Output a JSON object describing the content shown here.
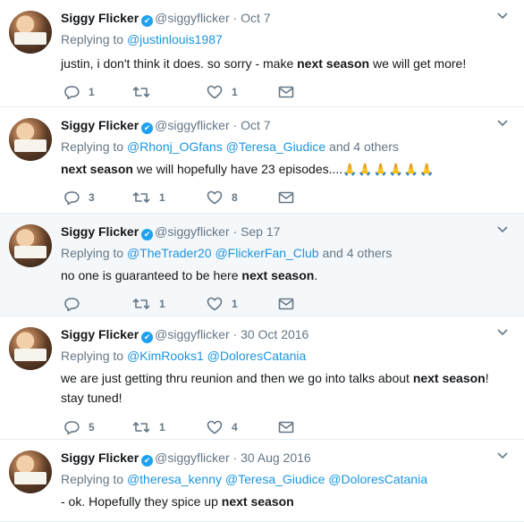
{
  "tweets": [
    {
      "name": "Siggy Flicker",
      "handle": "@siggyflicker",
      "date": "Oct 7",
      "replying_label": "Replying to",
      "replying": [
        "@justinlouis1987"
      ],
      "replying_more": "",
      "text_before": "justin, i don't think it does. so sorry - make ",
      "text_bold": "next season",
      "text_after": " we will get more!",
      "emoji": "",
      "replies": "1",
      "retweets": "",
      "likes": "1"
    },
    {
      "name": "Siggy Flicker",
      "handle": "@siggyflicker",
      "date": "Oct 7",
      "replying_label": "Replying to",
      "replying": [
        "@Rhonj_OGfans",
        "@Teresa_Giudice"
      ],
      "replying_more": "and 4 others",
      "text_before": "",
      "text_bold": "next season",
      "text_after": " we will hopefully have 23 episodes....",
      "emoji": "🙏🙏🙏🙏🙏🙏",
      "replies": "3",
      "retweets": "1",
      "likes": "8"
    },
    {
      "name": "Siggy Flicker",
      "handle": "@siggyflicker",
      "date": "Sep 17",
      "replying_label": "Replying to",
      "replying": [
        "@TheTrader20",
        "@FlickerFan_Club"
      ],
      "replying_more": "and 4 others",
      "text_before": "no one is guaranteed to be here ",
      "text_bold": "next season",
      "text_after": ".",
      "emoji": "",
      "replies": "",
      "retweets": "1",
      "likes": "1"
    },
    {
      "name": "Siggy Flicker",
      "handle": "@siggyflicker",
      "date": "30 Oct 2016",
      "replying_label": "Replying to",
      "replying": [
        "@KimRooks1",
        "@DoloresCatania"
      ],
      "replying_more": "",
      "text_before": "we are just getting thru reunion and then we go into talks about ",
      "text_bold": "next season",
      "text_after": "! stay tuned!",
      "emoji": "",
      "replies": "5",
      "retweets": "1",
      "likes": "4"
    },
    {
      "name": "Siggy Flicker",
      "handle": "@siggyflicker",
      "date": "30 Aug 2016",
      "replying_label": "Replying to",
      "replying": [
        "@theresa_kenny",
        "@Teresa_Giudice",
        "@DoloresCatania"
      ],
      "replying_more": "",
      "text_before": "- ok. Hopefully they spice up ",
      "text_bold": "next season",
      "text_after": "",
      "emoji": "",
      "replies": "",
      "retweets": "",
      "likes": ""
    }
  ],
  "verified_glyph": "✔",
  "colors": {
    "link": "#1b95e0",
    "muted": "#657786",
    "verified": "#1da1f2",
    "highlight": "#f5f8fa"
  },
  "icons": [
    "reply-icon",
    "retweet-icon",
    "like-icon",
    "message-icon",
    "chevron-down-icon",
    "verified-badge-icon"
  ]
}
